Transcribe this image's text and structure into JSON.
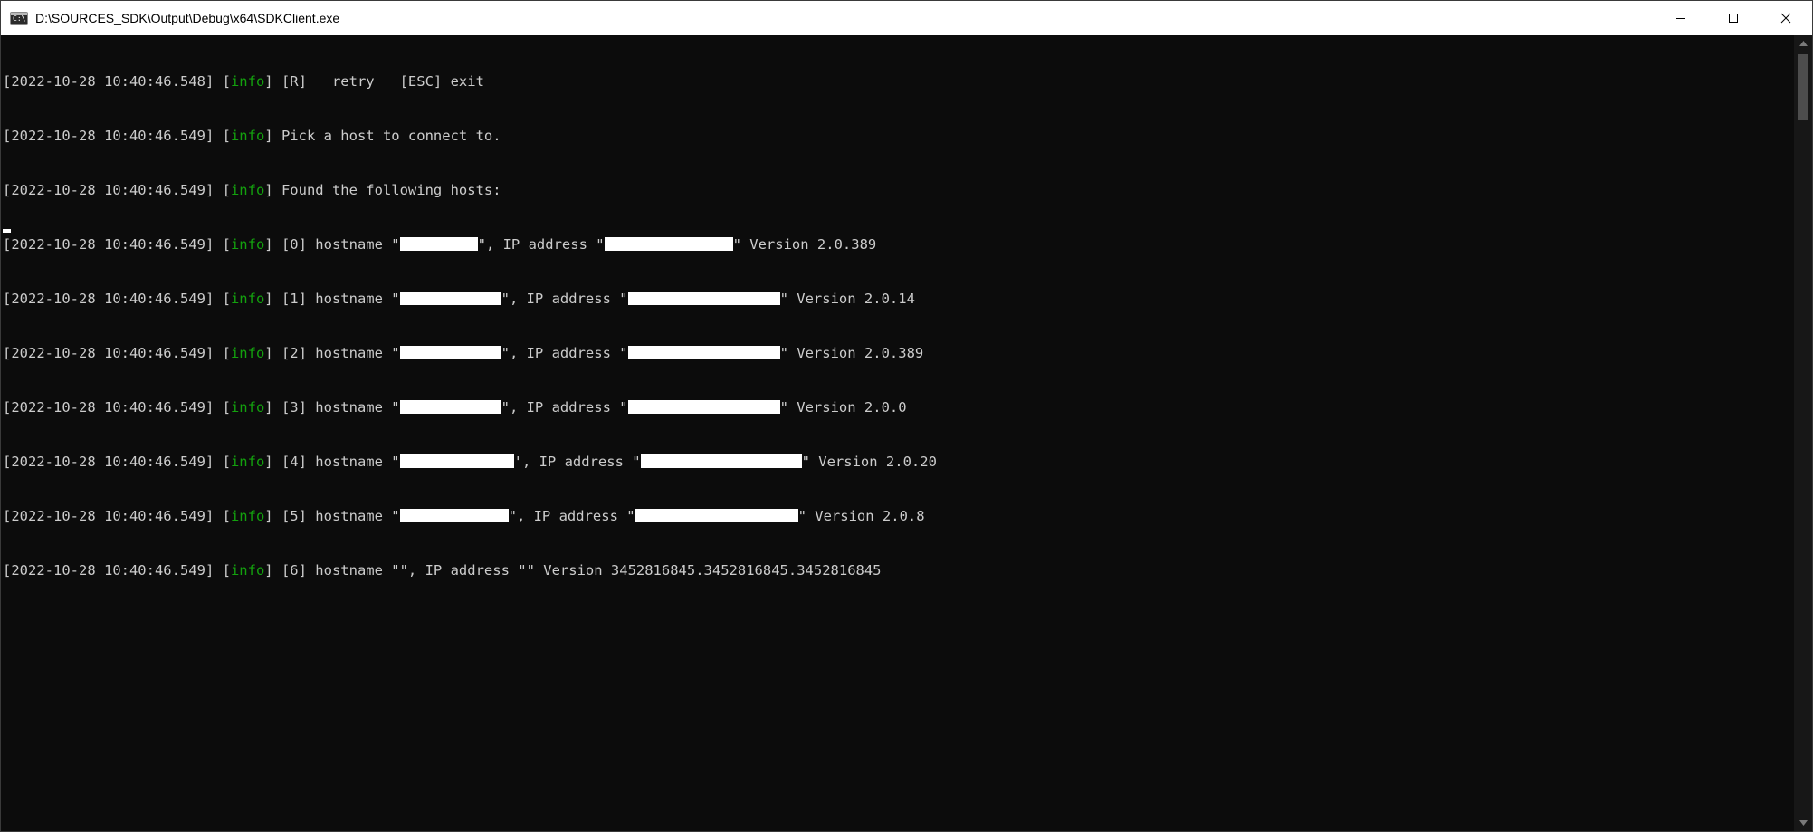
{
  "window": {
    "title": "D:\\SOURCES_SDK\\Output\\Debug\\x64\\SDKClient.exe",
    "icon": "console-app-icon",
    "icon_glyph": "C:\\",
    "controls": [
      "minimize-icon",
      "maximize-icon",
      "close-icon"
    ]
  },
  "colors": {
    "background": "#0c0c0c",
    "text": "#cccccc",
    "info_tag": "#13a10e",
    "redaction": "#ffffff"
  },
  "console": {
    "lines": [
      {
        "ts": "[2022-10-28 10:40:46.548]",
        "pre": " [",
        "tag": "info",
        "post": "] [R]   retry   [ESC] exit"
      },
      {
        "ts": "[2022-10-28 10:40:46.549]",
        "pre": " [",
        "tag": "info",
        "post": "] Pick a host to connect to."
      },
      {
        "ts": "[2022-10-28 10:40:46.549]",
        "pre": " [",
        "tag": "info",
        "post": "] Found the following hosts:"
      },
      {
        "ts": "[2022-10-28 10:40:46.549]",
        "pre": " [",
        "tag": "info",
        "post": "] [0] hostname \"",
        "r1": 1,
        "mid": "\", IP address \"",
        "r2": 1,
        "end": "\" Version 2.0.389"
      },
      {
        "ts": "[2022-10-28 10:40:46.549]",
        "pre": " [",
        "tag": "info",
        "post": "] [1] hostname \"",
        "r1": 1,
        "mid": "\", IP address \"",
        "r2": 1,
        "end": "\" Version 2.0.14"
      },
      {
        "ts": "[2022-10-28 10:40:46.549]",
        "pre": " [",
        "tag": "info",
        "post": "] [2] hostname \"",
        "r1": 1,
        "mid": "\", IP address \"",
        "r2": 1,
        "end": "\" Version 2.0.389"
      },
      {
        "ts": "[2022-10-28 10:40:46.549]",
        "pre": " [",
        "tag": "info",
        "post": "] [3] hostname \"",
        "r1": 1,
        "mid": "\", IP address \"",
        "r2": 1,
        "end": "\" Version 2.0.0"
      },
      {
        "ts": "[2022-10-28 10:40:46.549]",
        "pre": " [",
        "tag": "info",
        "post": "] [4] hostname \"",
        "r1": 1,
        "mid": "', IP address \"",
        "r2": 1,
        "end": "\" Version 2.0.20"
      },
      {
        "ts": "[2022-10-28 10:40:46.549]",
        "pre": " [",
        "tag": "info",
        "post": "] [5] hostname \"",
        "r1": 1,
        "mid": "\", IP address \"",
        "r2": 1,
        "end": "\" Version 2.0.8"
      },
      {
        "ts": "[2022-10-28 10:40:46.549]",
        "pre": " [",
        "tag": "info",
        "post": "] [6] hostname \"\", IP address \"\" Version 3452816845.3452816845.3452816845"
      }
    ]
  }
}
